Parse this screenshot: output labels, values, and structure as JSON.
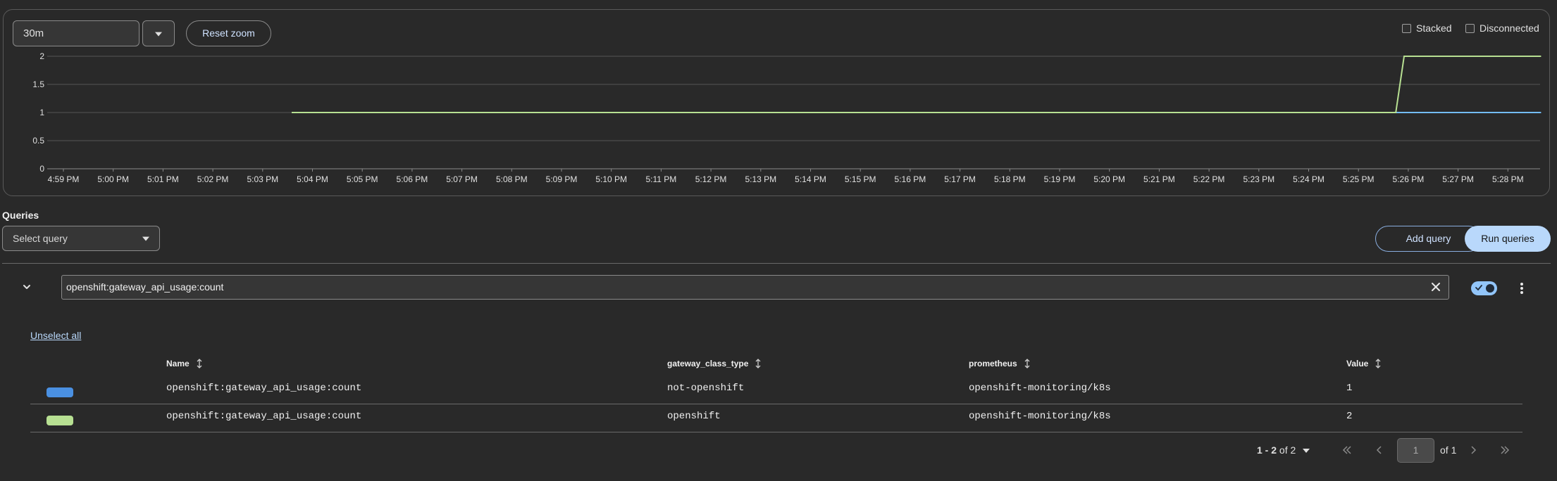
{
  "graph": {
    "time_range": "30m",
    "reset_zoom_label": "Reset zoom",
    "stacked_label": "Stacked",
    "disconnected_label": "Disconnected"
  },
  "chart_data": {
    "type": "line",
    "yticks": [
      "2",
      "1.5",
      "1",
      "0.5",
      "0"
    ],
    "ylim": [
      0,
      2
    ],
    "xticks": [
      "4:59 PM",
      "5:00 PM",
      "5:01 PM",
      "5:02 PM",
      "5:03 PM",
      "5:04 PM",
      "5:05 PM",
      "5:06 PM",
      "5:07 PM",
      "5:08 PM",
      "5:09 PM",
      "5:10 PM",
      "5:11 PM",
      "5:12 PM",
      "5:13 PM",
      "5:14 PM",
      "5:15 PM",
      "5:16 PM",
      "5:17 PM",
      "5:18 PM",
      "5:19 PM",
      "5:20 PM",
      "5:21 PM",
      "5:22 PM",
      "5:23 PM",
      "5:24 PM",
      "5:25 PM",
      "5:26 PM",
      "5:27 PM",
      "5:28 PM"
    ],
    "grid": true,
    "series": [
      {
        "color": "#73bcf7",
        "points": [
          [
            "5:03:35 PM",
            1
          ],
          [
            "5:28:40 PM",
            1
          ]
        ]
      },
      {
        "color": "#b7e092",
        "points": [
          [
            "5:03:35 PM",
            1
          ],
          [
            "5:25:45 PM",
            1
          ],
          [
            "5:25:55 PM",
            2
          ],
          [
            "5:28:40 PM",
            2
          ]
        ]
      }
    ]
  },
  "queries": {
    "title": "Queries",
    "select_placeholder": "Select query",
    "add_query_label": "Add query",
    "run_queries_label": "Run queries",
    "expression": "openshift:gateway_api_usage:count",
    "enabled": true,
    "unselect_all_label": "Unselect all"
  },
  "table": {
    "headers": {
      "name": "Name",
      "gateway_class_type": "gateway_class_type",
      "prometheus": "prometheus",
      "value": "Value"
    },
    "rows": [
      {
        "color": "#4a90e2",
        "name": "openshift:gateway_api_usage:count",
        "gateway_class_type": "not-openshift",
        "prometheus": "openshift-monitoring/k8s",
        "value": "1"
      },
      {
        "color": "#b7e092",
        "name": "openshift:gateway_api_usage:count",
        "gateway_class_type": "openshift",
        "prometheus": "openshift-monitoring/k8s",
        "value": "2"
      }
    ]
  },
  "pagination": {
    "range": "1 - 2",
    "of_total": "of 2",
    "current_page": "1",
    "of_pages": "of 1"
  }
}
